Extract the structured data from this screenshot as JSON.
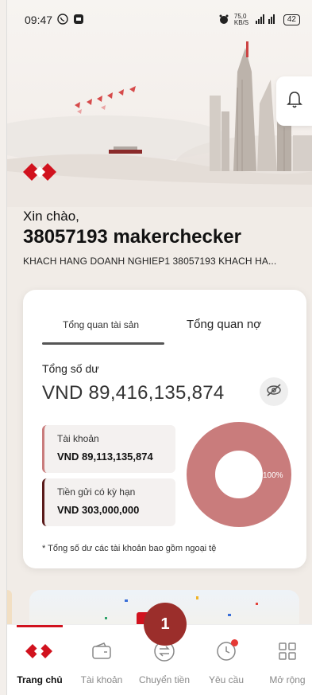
{
  "status": {
    "time": "09:47",
    "network_speed": "75,0 KB/S",
    "battery": "42"
  },
  "header": {
    "greeting": "Xin chào,",
    "user_name": "38057193 makerchecker",
    "company": "KHACH HANG DOANH NGHIEP1 38057193 KHACH HA..."
  },
  "overview": {
    "tabs": [
      "Tổng quan tài sản",
      "Tổng quan nợ"
    ],
    "active_tab": 0,
    "balance_label": "Tổng số dư",
    "balance_value": "VND 89,416,135,874",
    "accounts": [
      {
        "label": "Tài khoản",
        "value": "VND 89,113,135,874"
      },
      {
        "label": "Tiền gửi có kỳ hạn",
        "value": "VND 303,000,000"
      }
    ],
    "donut_percent_label": "100%",
    "donut_percent": 100,
    "footnote": "* Tổng số dư các tài khoản bao gồm ngoại tệ"
  },
  "bottom_nav": [
    {
      "label": "Trang chủ",
      "icon": "home-logo-icon"
    },
    {
      "label": "Tài khoản",
      "icon": "wallet-icon"
    },
    {
      "label": "Chuyển tiền",
      "icon": "transfer-icon"
    },
    {
      "label": "Yêu cầu",
      "icon": "clock-icon"
    },
    {
      "label": "Mở rộng",
      "icon": "grid-icon"
    }
  ],
  "step_badge": "1",
  "colors": {
    "brand_red": "#d1121e",
    "donut": "#c97c7c",
    "badge": "#9b2e2b"
  }
}
